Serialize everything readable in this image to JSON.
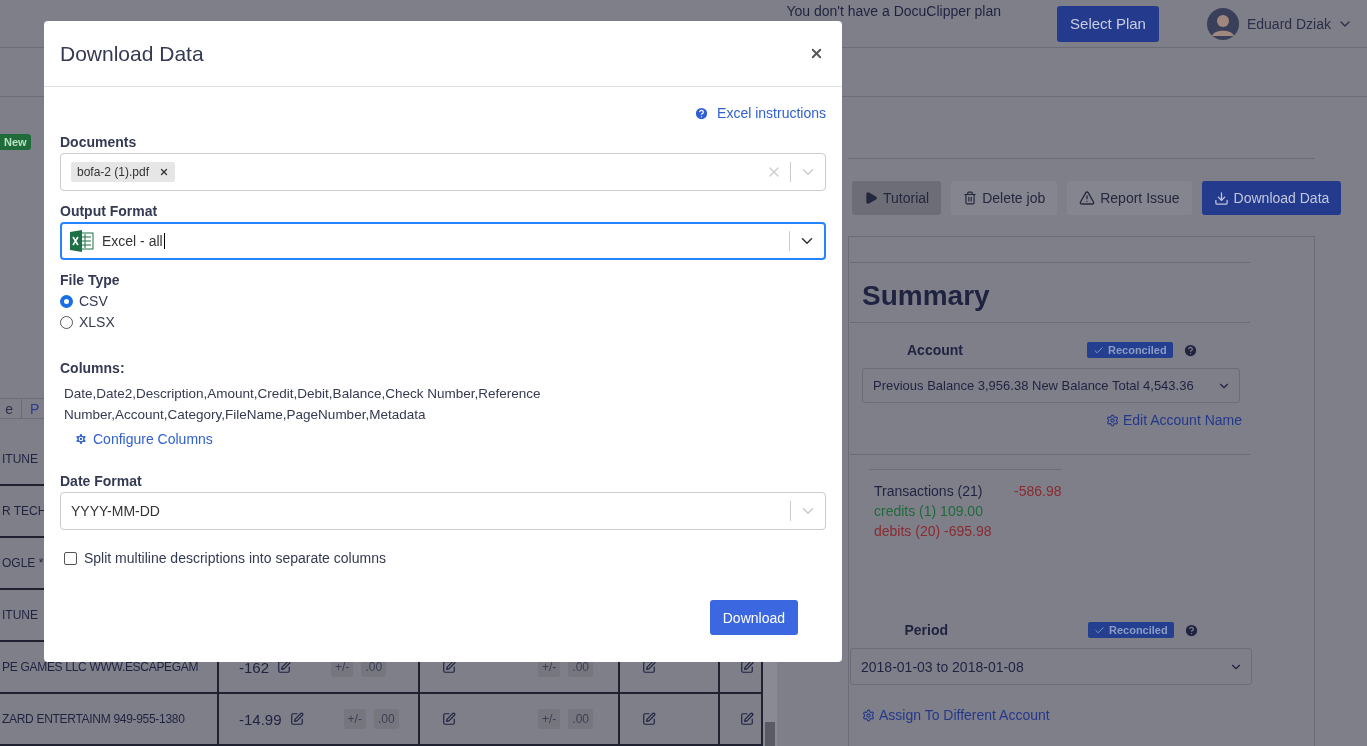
{
  "header": {
    "plan_notice": "You don't have a DocuClipper plan",
    "select_plan": "Select Plan",
    "user_name": "Eduard Dziak"
  },
  "sidebar_badge": "New",
  "tabs": [
    {
      "label": "e",
      "selected": false
    },
    {
      "label": "P",
      "selected": true
    }
  ],
  "transactions": [
    {
      "description": "ITUNE"
    },
    {
      "description": "R TECH"
    },
    {
      "description": "OGLE *"
    },
    {
      "description": "ITUNE"
    },
    {
      "description": "PE GAMES LLC WWW.ESCAPEGAM",
      "amount": "-162",
      "adjust": "+/-",
      "cents": ".00",
      "adjust_2": "+/-",
      "cents_2": ".00"
    },
    {
      "description": "ZARD ENTERTAINM 949-955-1380",
      "amount": "-14.99",
      "adjust": "+/-",
      "cents": ".00",
      "adjust_2": "+/-",
      "cents_2": ".00"
    }
  ],
  "toolbar": [
    {
      "label": "Tutorial",
      "kind": "tutorial",
      "primary": false
    },
    {
      "label": "Delete job",
      "kind": "delete",
      "primary": false
    },
    {
      "label": "Report Issue",
      "kind": "report",
      "primary": false
    },
    {
      "label": "Download Data",
      "kind": "download",
      "primary": true
    }
  ],
  "summary": {
    "title": "Summary",
    "account": {
      "label": "Account",
      "badge": "Reconciled",
      "value": "Previous Balance 3,956.38 New Balance Total 4,543.36",
      "link": "Edit Account Name"
    },
    "totals": {
      "transactions": "Transactions (21)",
      "amount": "-586.98",
      "credits": "credits (1) 109.00",
      "debits": "debits (20) -695.98"
    },
    "period": {
      "label": "Period",
      "badge": "Reconciled",
      "value": "2018-01-03 to 2018-01-08"
    },
    "assign_link": "Assign To Different Account"
  },
  "modal": {
    "title": "Download Data",
    "help_link": "Excel instructions",
    "documents": {
      "label": "Documents",
      "tags": [
        "bofa-2 (1).pdf"
      ]
    },
    "output_format": {
      "label": "Output Format",
      "value": "Excel - all"
    },
    "file_type": {
      "label": "File Type",
      "options": [
        {
          "label": "CSV",
          "selected": true
        },
        {
          "label": "XLSX",
          "selected": false
        }
      ]
    },
    "columns": {
      "label": "Columns:",
      "value": "Date,Date2,Description,Amount,Credit,Debit,Balance,Check Number,Reference Number,Account,Category,FileName,PageNumber,Metadata",
      "link": "Configure Columns"
    },
    "date_format": {
      "label": "Date Format",
      "value": "YYYY-MM-DD"
    },
    "split": {
      "label": "Split multiline descriptions into separate columns",
      "checked": false
    },
    "submit": "Download"
  }
}
